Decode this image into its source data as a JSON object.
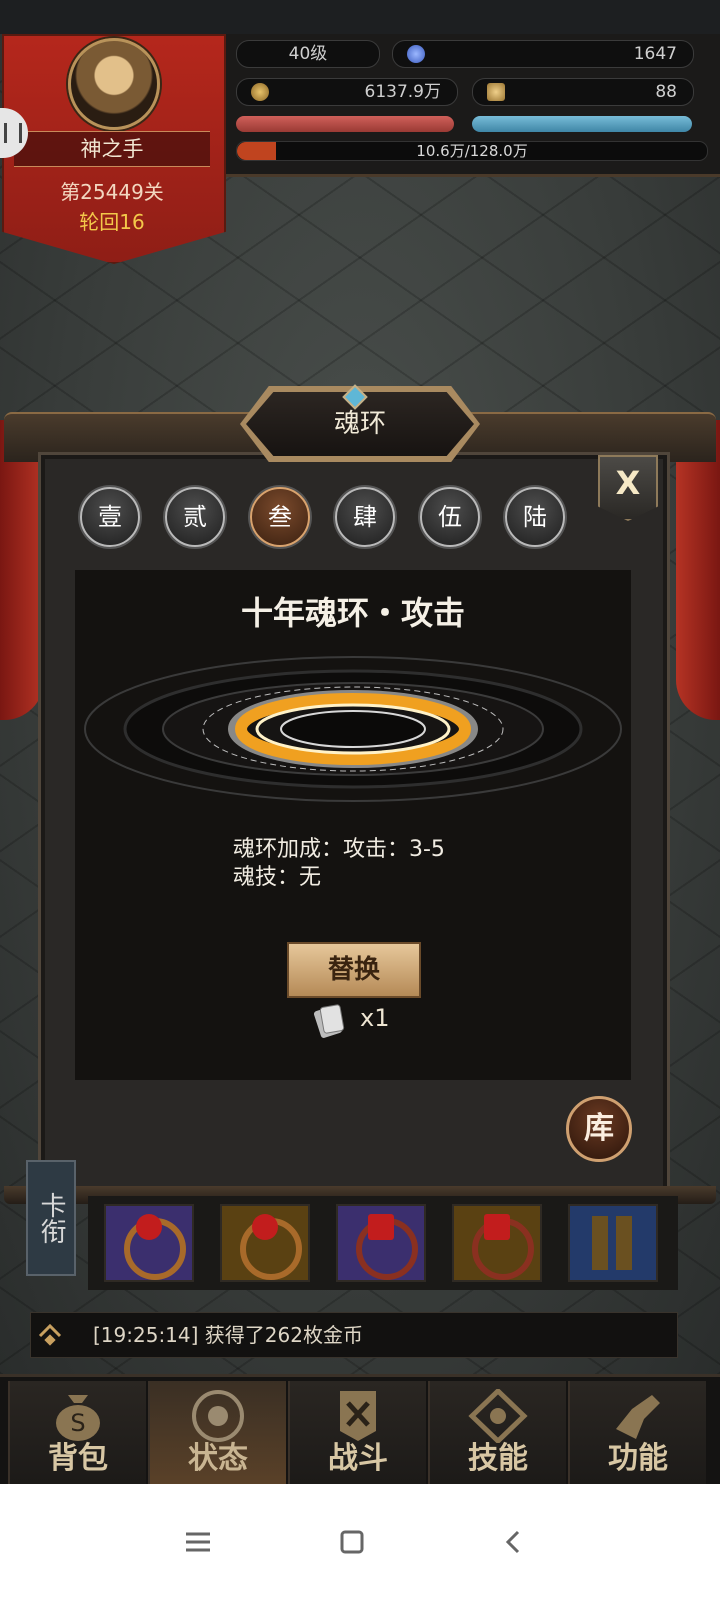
{
  "player": {
    "level": "40级",
    "diamonds": "1647",
    "gold": "6137.9万",
    "tickets": "88",
    "name": "神之手",
    "stage": "第25449关",
    "cycle": "轮回16",
    "exp_text": "10.6万/128.0万",
    "exp_progress": 0.083
  },
  "dialog": {
    "title": "魂环",
    "close_label": "X",
    "tabs": [
      "壹",
      "贰",
      "叁",
      "肆",
      "伍",
      "陆"
    ],
    "active_tab": 2,
    "ring_name": "十年魂环・攻击",
    "bonus_line": "魂环加成：攻击：3-5",
    "skill_line": "魂技：无",
    "replace_label": "替换",
    "cost_text": "x1",
    "library_label": "库"
  },
  "left_panel_label": "卡衔",
  "log": {
    "text": "[19:25:14] 获得了262枚金币"
  },
  "nav": {
    "items": [
      {
        "label": "背包",
        "icon": "bag-icon"
      },
      {
        "label": "状态",
        "icon": "status-icon"
      },
      {
        "label": "战斗",
        "icon": "battle-icon"
      },
      {
        "label": "技能",
        "icon": "skills-icon"
      },
      {
        "label": "功能",
        "icon": "function-icon"
      }
    ],
    "active": 1
  },
  "colors": {
    "accent_gold": "#d3933a",
    "banner_red": "#b5271c",
    "hp_bar": "#c0504a",
    "mp_bar": "#5fa3c0"
  }
}
